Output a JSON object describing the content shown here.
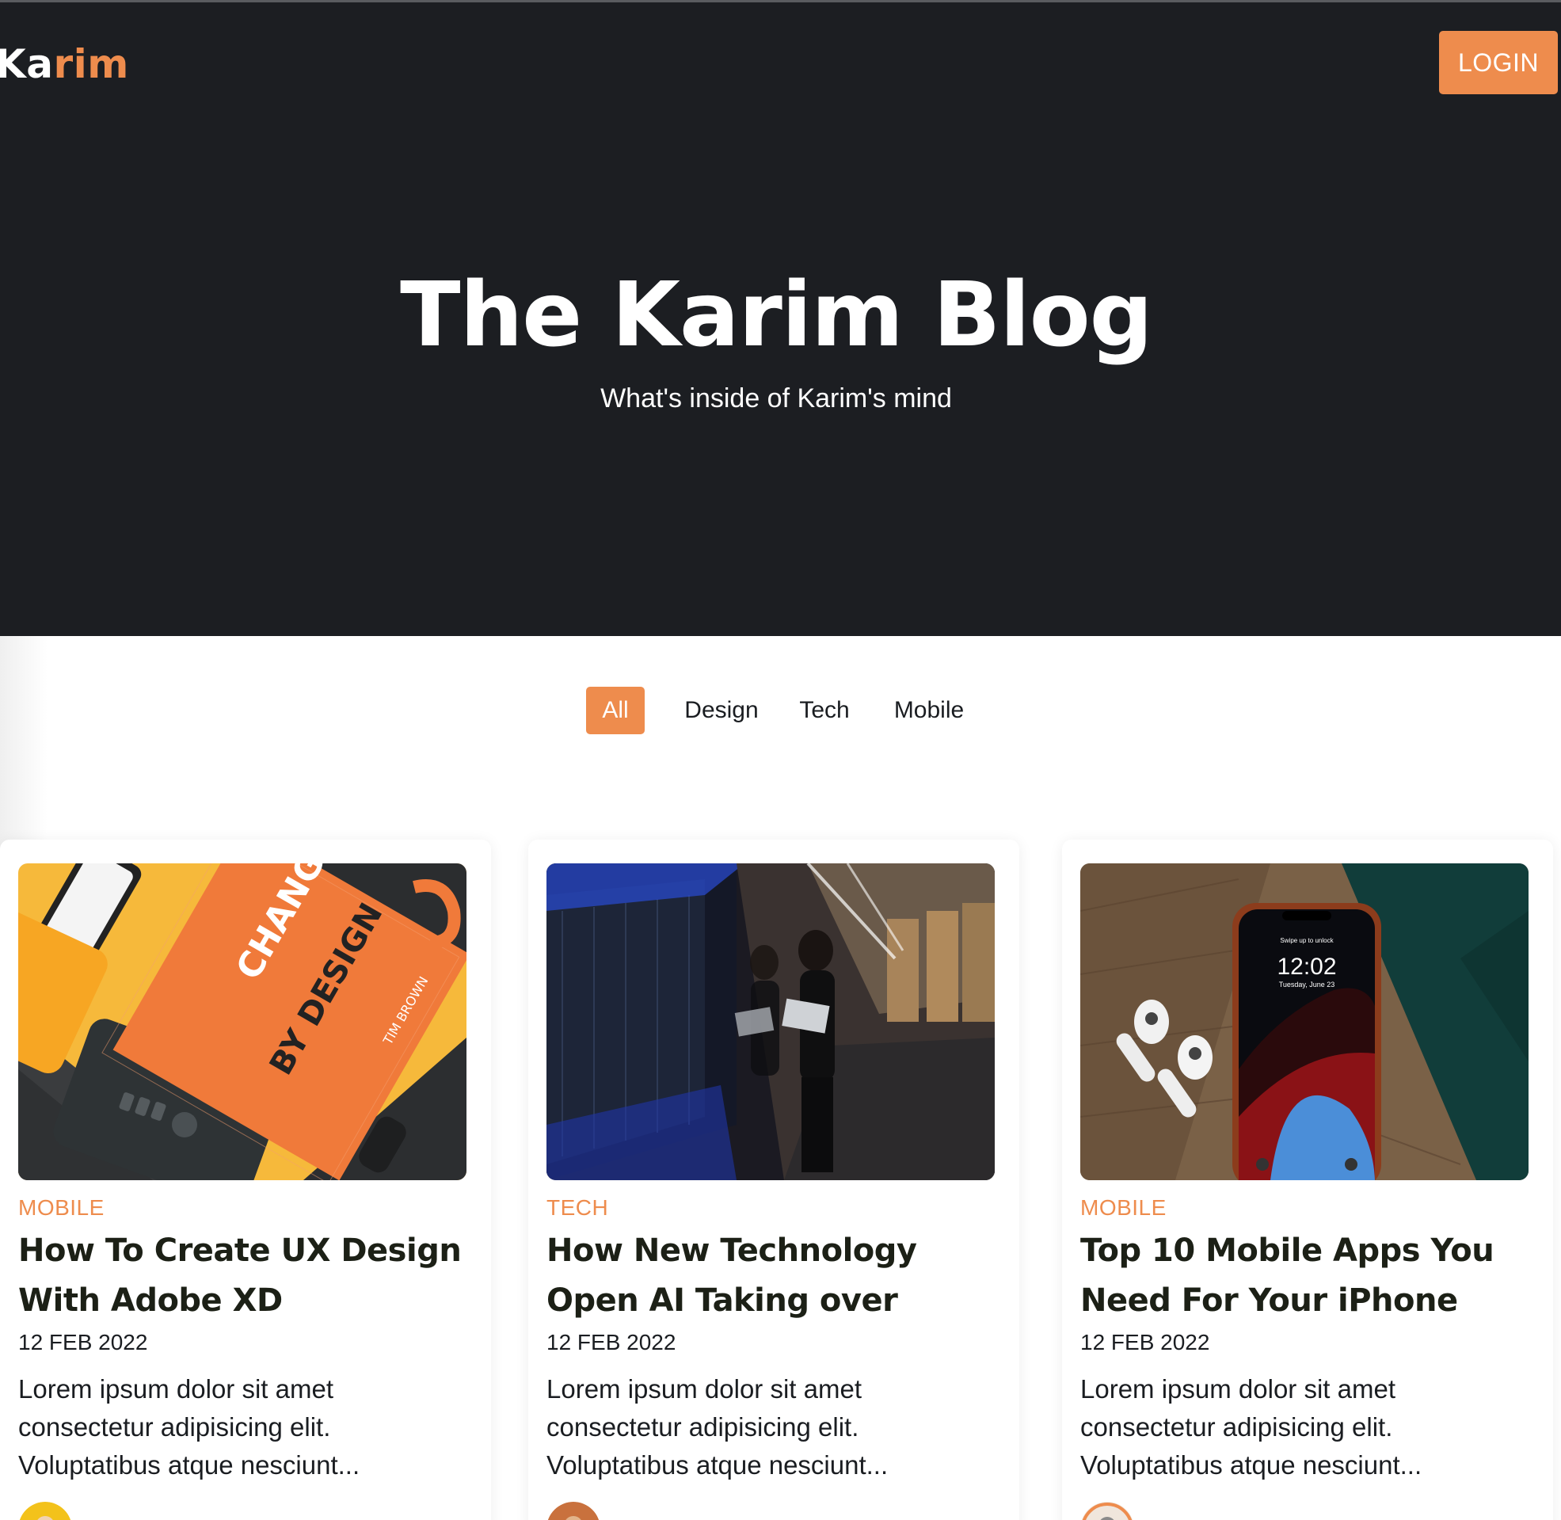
{
  "colors": {
    "accent": "#ee8c4d",
    "hero_bg": "#1c1e22",
    "title_text": "#1c2016"
  },
  "header": {
    "logo_prefix": "Ka",
    "logo_suffix": "rim",
    "login_label": "LOGIN"
  },
  "hero": {
    "title": "The Karim Blog",
    "subtitle": "What's inside of Karim's mind"
  },
  "filters": {
    "all": "All",
    "design": "Design",
    "tech": "Tech",
    "mobile": "Mobile",
    "active": "All"
  },
  "posts": [
    {
      "category": "MOBILE",
      "title": "How To Create UX Design With Adobe XD",
      "date": "12 FEB 2022",
      "excerpt": "Lorem ipsum dolor sit amet consectetur adipisicing elit. Voluptatibus atque nesciunt...",
      "image_text_main": "CHANGE",
      "image_text_by": "BY DESIGN",
      "image_text_author": "TIM BROWN"
    },
    {
      "category": "TECH",
      "title": "How New Technology Open AI Taking over",
      "date": "12 FEB 2022",
      "excerpt": "Lorem ipsum dolor sit amet consectetur adipisicing elit. Voluptatibus atque nesciunt..."
    },
    {
      "category": "MOBILE",
      "title": "Top 10 Mobile Apps You Need For Your iPhone",
      "date": "12 FEB 2022",
      "excerpt": "Lorem ipsum dolor sit amet consectetur adipisicing elit. Voluptatibus atque nesciunt...",
      "image_text_time": "12:02",
      "image_text_date": "Tuesday, June 23",
      "image_text_unlock": "Swipe up to unlock"
    }
  ]
}
